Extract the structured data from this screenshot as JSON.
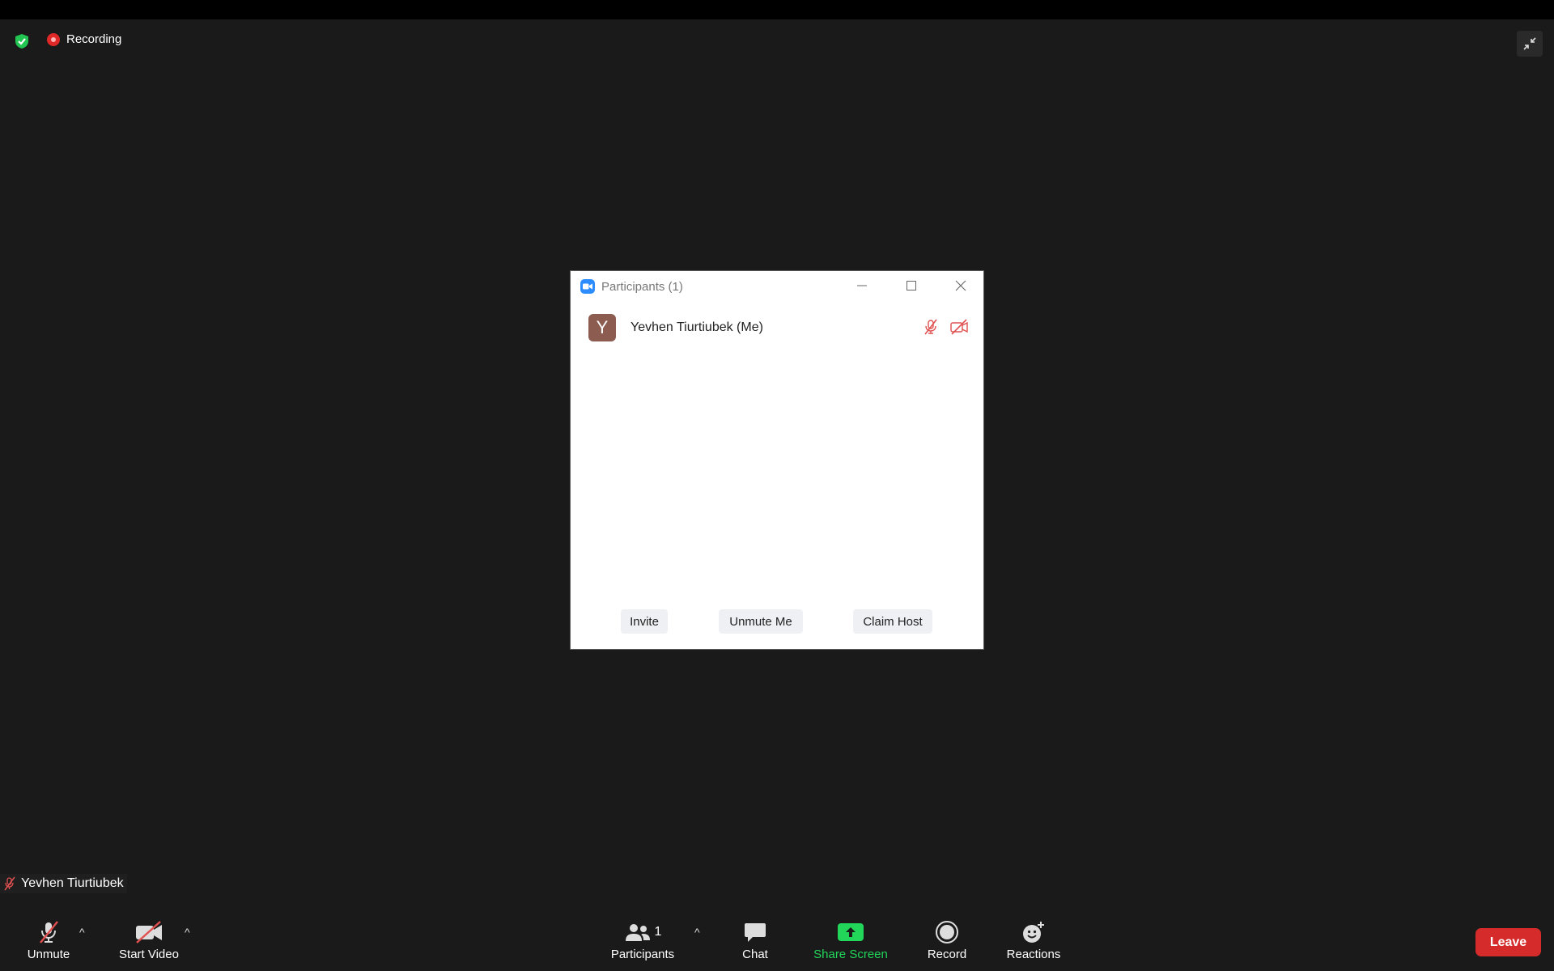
{
  "meeting": {
    "recording_label": "Recording",
    "self_name_tag": "Yevhen Tiurtiubek"
  },
  "participants_dialog": {
    "title": "Participants (1)",
    "participants": [
      {
        "initial": "Y",
        "name": "Yevhen Tiurtiubek (Me)",
        "avatar_color": "#8c5c50",
        "mic": "muted",
        "video": "off"
      }
    ],
    "buttons": {
      "invite": "Invite",
      "unmute_me": "Unmute Me",
      "claim_host": "Claim Host"
    }
  },
  "toolbar": {
    "unmute_label": "Unmute",
    "start_video_label": "Start Video",
    "participants_label": "Participants",
    "participants_count": "1",
    "chat_label": "Chat",
    "share_screen_label": "Share Screen",
    "record_label": "Record",
    "reactions_label": "Reactions",
    "leave_label": "Leave"
  },
  "colors": {
    "background": "#1a1a1a",
    "recording_red": "#e02828",
    "share_green": "#22d65a",
    "leave_red": "#d52b2b",
    "zoom_blue": "#2d8cff",
    "muted_red": "#e05050"
  }
}
